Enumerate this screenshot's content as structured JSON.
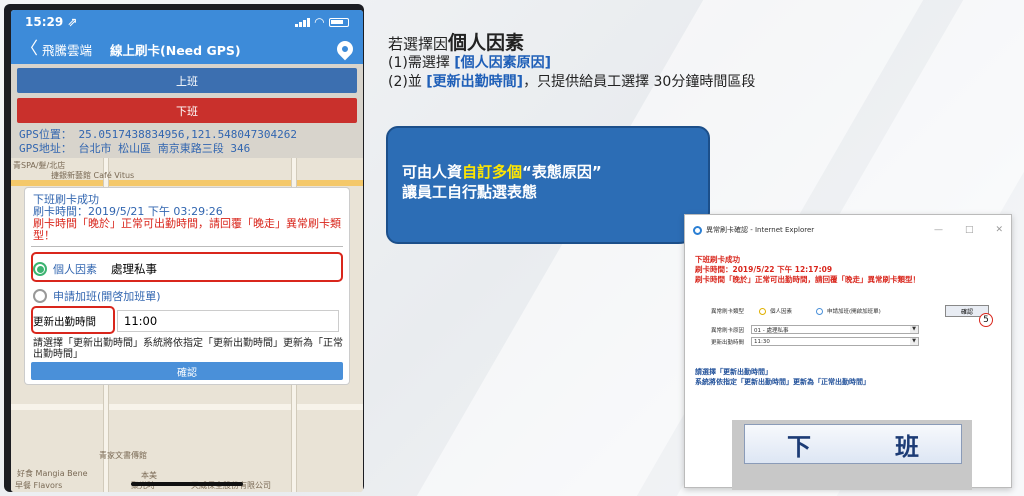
{
  "phone": {
    "status": {
      "time": "15:29 ⇗"
    },
    "nav": {
      "back": "〈",
      "app": "飛騰雲端",
      "title": "線上刷卡(Need GPS)"
    },
    "buttons": {
      "clock_in": "上班",
      "clock_out": "下班"
    },
    "gps": {
      "position": "GPS位置： 25.0517438834956,121.548047304262",
      "address": "GPS地址： 台北市 松山區 南京東路三段 346"
    },
    "map_labels": [
      "青SPA/髮/北店",
      "捷銀新藝館 Café Vitus",
      "青家文書傳館",
      "好食 Mangia Bene",
      "本美",
      "天威保全股份有限公司",
      "早餐 Flavors",
      "聚光時",
      "龍江路50巷",
      "45隨公寓",
      "Leoal",
      "龍江路60巷"
    ],
    "dialog": {
      "title_line1": "下班刷卡成功",
      "title_line2": "刷卡時間：2019/5/21 下午 03:29:26",
      "warning": "刷卡時間「晚於」正常可出勤時間，請回覆「晚走」異常刷卡類型！",
      "option1_label": "個人因素",
      "option1_value": "處理私事",
      "option2_label": "申請加班(開啓加班單)",
      "time_label": "更新出勤時間",
      "time_value": "11:00",
      "description": "請選擇「更新出勤時間」系統將依指定「更新出勤時間」更新為「正常出勤時間」",
      "ok": "確認"
    }
  },
  "headline": {
    "prefix": "若選擇因",
    "bold": "個人因素",
    "line1_prefix": "(1)需選擇 ",
    "line1_blue": "[個人因素原因]",
    "line2_prefix": "(2)並 ",
    "line2_blue": "[更新出勤時間]",
    "line2_suffix": "，只提供給員工選擇 30分鐘時間區段"
  },
  "callout": {
    "line1_prefix": "可由人資",
    "line1_yellow": "自訂多個",
    "line1_suffix": "“表態原因”",
    "line2": "讓員工自行點選表態"
  },
  "ie_window": {
    "title": "異常刷卡確認 - Internet Explorer",
    "controls": {
      "min": "—",
      "max": "□",
      "close": "✕"
    },
    "line1": "下班刷卡成功",
    "line2": "刷卡時間：2019/5/22 下午 12:17:09",
    "line3": "刷卡時間「晚於」正常可出勤時間，請回覆「晚走」異常刷卡類型！",
    "type_label": "異常刷卡類型",
    "radio1": "個人因素",
    "radio2": "申請加班(開啟加班單)",
    "reason_label": "異常刷卡原因",
    "reason_value": "01 - 處理私事",
    "time_label": "更新出勤時間",
    "time_value": "11:30",
    "confirm": "確認",
    "marker": "5",
    "note1": "請選擇「更新出勤時間」",
    "note2": "系統將依指定「更新出勤時間」更新為「正常出勤時間」",
    "big_left": "下",
    "big_right": "班"
  },
  "colors": {
    "accent": "#3d8bd9",
    "warning": "#d9261c",
    "callout": "#2c6db5",
    "highlight": "#ffe600"
  }
}
